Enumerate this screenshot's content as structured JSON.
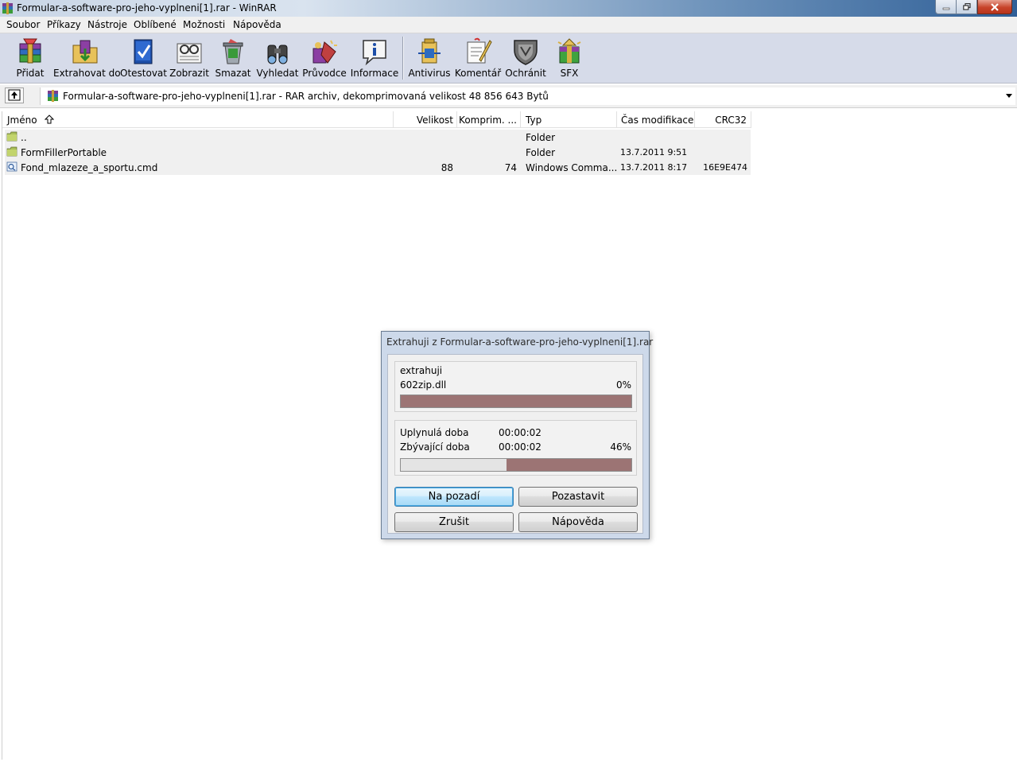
{
  "window": {
    "title": "Formular-a-software-pro-jeho-vyplneni[1].rar - WinRAR"
  },
  "menu": {
    "items": [
      "Soubor",
      "Příkazy",
      "Nástroje",
      "Oblíbené",
      "Možnosti",
      "Nápověda"
    ]
  },
  "toolbar": {
    "buttons": [
      {
        "label": "Přidat",
        "icon": "add-archive-icon"
      },
      {
        "label": "Extrahovat do",
        "icon": "extract-to-icon"
      },
      {
        "label": "Otestovat",
        "icon": "test-icon"
      },
      {
        "label": "Zobrazit",
        "icon": "view-icon"
      },
      {
        "label": "Smazat",
        "icon": "delete-icon"
      },
      {
        "label": "Vyhledat",
        "icon": "find-icon"
      },
      {
        "label": "Průvodce",
        "icon": "wizard-icon"
      },
      {
        "label": "Informace",
        "icon": "info-icon"
      },
      {
        "label": "Antivirus",
        "icon": "antivirus-icon"
      },
      {
        "label": "Komentář",
        "icon": "comment-icon"
      },
      {
        "label": "Ochránit",
        "icon": "protect-icon"
      },
      {
        "label": "SFX",
        "icon": "sfx-icon"
      }
    ]
  },
  "address": {
    "text": "Formular-a-software-pro-jeho-vyplneni[1].rar - RAR archiv, dekomprimovaná velikost 48 856 643 Bytů"
  },
  "filelist": {
    "columns": [
      "Jméno",
      "Velikost",
      "Komprim. ...",
      "Typ",
      "Čas modifikace",
      "CRC32"
    ],
    "rows": [
      {
        "name": "..",
        "size": "",
        "packed": "",
        "type": "Folder",
        "modified": "",
        "crc": "",
        "icon": "folder-icon"
      },
      {
        "name": "FormFillerPortable",
        "size": "",
        "packed": "",
        "type": "Folder",
        "modified": "13.7.2011 9:51",
        "crc": "",
        "icon": "folder-icon"
      },
      {
        "name": "Fond_mlazeze_a_sportu.cmd",
        "size": "88",
        "packed": "74",
        "type": "Windows Comma...",
        "modified": "13.7.2011 8:17",
        "crc": "16E9E474",
        "icon": "cmd-file-icon"
      }
    ]
  },
  "dialog": {
    "title": "Extrahuji z Formular-a-software-pro-jeho-vyplneni[1].rar",
    "action": "extrahuji",
    "file": "602zip.dll",
    "file_percent": "0%",
    "file_progress": 1.0,
    "elapsed_label": "Uplynulá doba",
    "elapsed_value": "00:00:02",
    "remaining_label": "Zbývající doba",
    "remaining_value": "00:00:02",
    "total_percent": "46%",
    "total_progress": 0.54,
    "buttons": {
      "background": "Na pozadí",
      "pause": "Pozastavit",
      "cancel": "Zrušit",
      "help": "Nápověda"
    }
  }
}
